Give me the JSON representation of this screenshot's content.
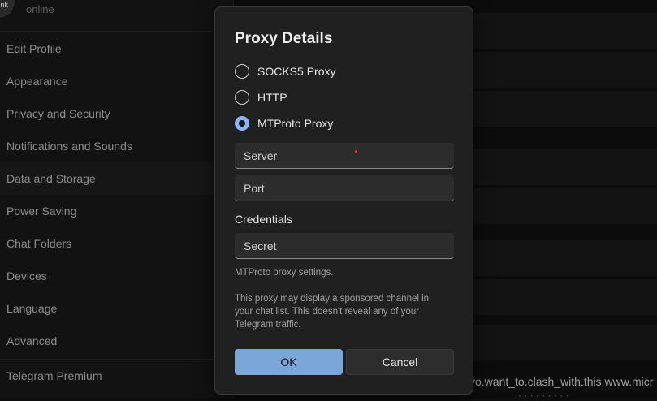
{
  "background": {
    "profile": {
      "avatar_text": "nk",
      "status": "online"
    },
    "menu": [
      "Edit Profile",
      "Appearance",
      "Privacy and Security",
      "Notifications and Sounds",
      "Data and Storage",
      "Power Saving",
      "Chat Folders",
      "Devices",
      "Language",
      "Advanced"
    ],
    "premium": "Telegram Premium",
    "bottom_text": "vo.want_to.clash_with.this.www.micr",
    "bottom_text2": "· · · · · · · · ·"
  },
  "dialog": {
    "title": "Proxy Details",
    "proxy_types": [
      {
        "label": "SOCKS5 Proxy",
        "checked": false
      },
      {
        "label": "HTTP",
        "checked": false
      },
      {
        "label": "MTProto Proxy",
        "checked": true
      }
    ],
    "server_placeholder": "Server",
    "port_placeholder": "Port",
    "credentials_label": "Credentials",
    "secret_placeholder": "Secret",
    "settings_note": "MTProto proxy settings.",
    "sponsored_note": "This proxy may display a sponsored channel in your chat list. This doesn't reveal any of your Telegram traffic.",
    "ok_label": "OK",
    "cancel_label": "Cancel"
  },
  "colors": {
    "accent": "#8ab4f8",
    "ok_button": "#7aa6d8",
    "dialog_bg": "#202020"
  }
}
